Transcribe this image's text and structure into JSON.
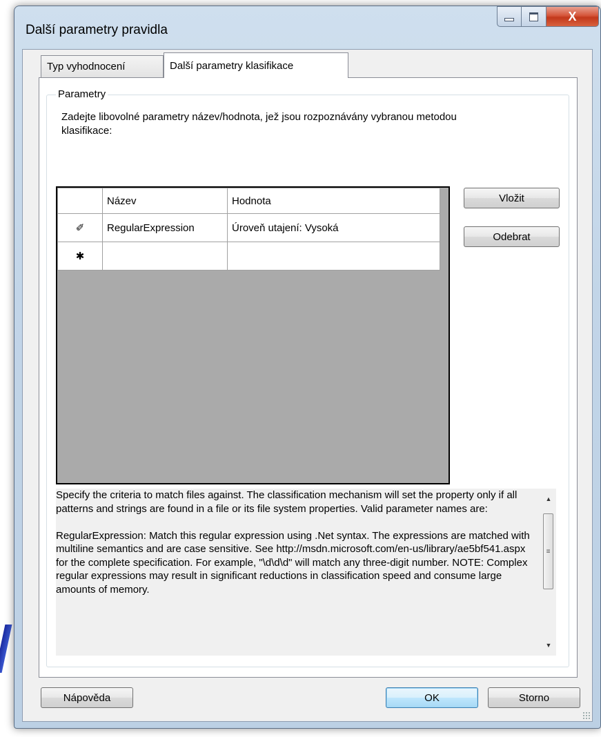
{
  "window": {
    "title": "Další parametry pravidla",
    "controls": {
      "minimize_icon": "minimize-icon",
      "maximize_icon": "maximize-icon",
      "close_glyph": "X"
    }
  },
  "tabs": [
    {
      "label": "Typ vyhodnocení",
      "selected": false
    },
    {
      "label": "Další parametry klasifikace",
      "selected": true
    }
  ],
  "group": {
    "legend": "Parametry",
    "description": "Zadejte libovolné parametry název/hodnota, jež jsou rozpoznávány vybranou metodou klasifikace:"
  },
  "grid": {
    "columns": [
      "Název",
      "Hodnota"
    ],
    "rows": [
      {
        "indicator": "✐",
        "indicator_icon": "pencil-icon",
        "name": "RegularExpression",
        "value": "Úroveň utajení: Vysoká"
      },
      {
        "indicator": "✱",
        "indicator_icon": "asterisk-icon",
        "name": "",
        "value": ""
      }
    ]
  },
  "side_buttons": {
    "insert": "Vložit",
    "remove": "Odebrat"
  },
  "help": {
    "text": "Specify the criteria to match files against. The classification mechanism will set the property only if all patterns and strings are found in a file or its file system properties. Valid parameter names are:\n\nRegularExpression: Match this regular expression using .Net syntax. The expressions are matched with multiline semantics and are case sensitive. See http://msdn.microsoft.com/en-us/library/ae5bf541.aspx for the complete specification. For example, \"\\d\\d\\d\" will match any three-digit number. NOTE: Complex regular expressions may result in significant reductions in classification speed and consume large amounts of memory."
  },
  "footer": {
    "help_button": "Nápověda",
    "ok_button": "OK",
    "cancel_button": "Storno"
  }
}
